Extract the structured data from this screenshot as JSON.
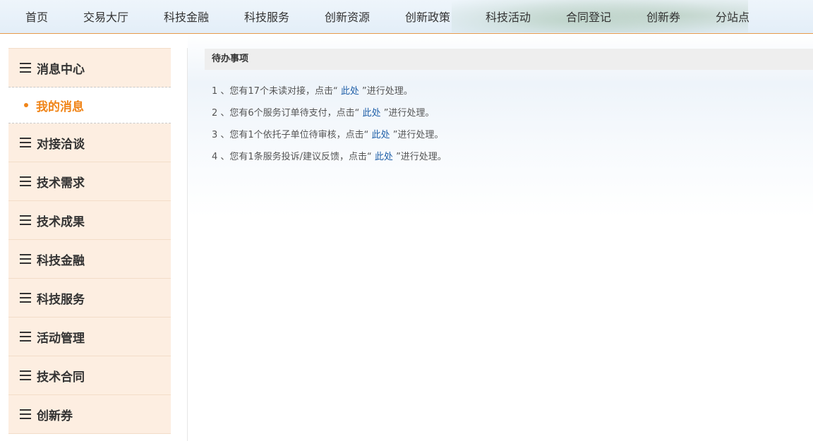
{
  "nav": {
    "items": [
      "首页",
      "交易大厅",
      "科技金融",
      "科技服务",
      "创新资源",
      "创新政策",
      "科技活动",
      "合同登记",
      "创新券",
      "分站点"
    ]
  },
  "sidebar": {
    "sections": [
      {
        "label": "消息中心",
        "icon": "menu-icon"
      },
      {
        "label": "对接洽谈",
        "icon": "menu-icon"
      },
      {
        "label": "技术需求",
        "icon": "menu-icon"
      },
      {
        "label": "技术成果",
        "icon": "menu-icon"
      },
      {
        "label": "科技金融",
        "icon": "menu-icon"
      },
      {
        "label": "科技服务",
        "icon": "menu-icon"
      },
      {
        "label": "活动管理",
        "icon": "menu-icon"
      },
      {
        "label": "技术合同",
        "icon": "menu-icon"
      },
      {
        "label": "创新券",
        "icon": "menu-icon"
      }
    ],
    "active_sub": {
      "label": "我的消息"
    }
  },
  "main": {
    "panel_title": "待办事项",
    "todos": [
      {
        "prefix": "1 、您有17个未读对接，点击“ ",
        "link": "此处",
        "suffix": " ”进行处理。"
      },
      {
        "prefix": "2 、您有6个服务订单待支付，点击“ ",
        "link": "此处",
        "suffix": " ”进行处理。"
      },
      {
        "prefix": "3 、您有1个依托子单位待审核，点击“ ",
        "link": "此处",
        "suffix": " ”进行处理。"
      },
      {
        "prefix": "4 、您有1条服务投诉/建议反馈，点击“ ",
        "link": "此处",
        "suffix": " ”进行处理。"
      }
    ]
  },
  "colors": {
    "accent": "#f08519",
    "link": "#1f5fa8",
    "sidebar_bg": "#fdeee1",
    "nav_border": "#e79a4b"
  }
}
